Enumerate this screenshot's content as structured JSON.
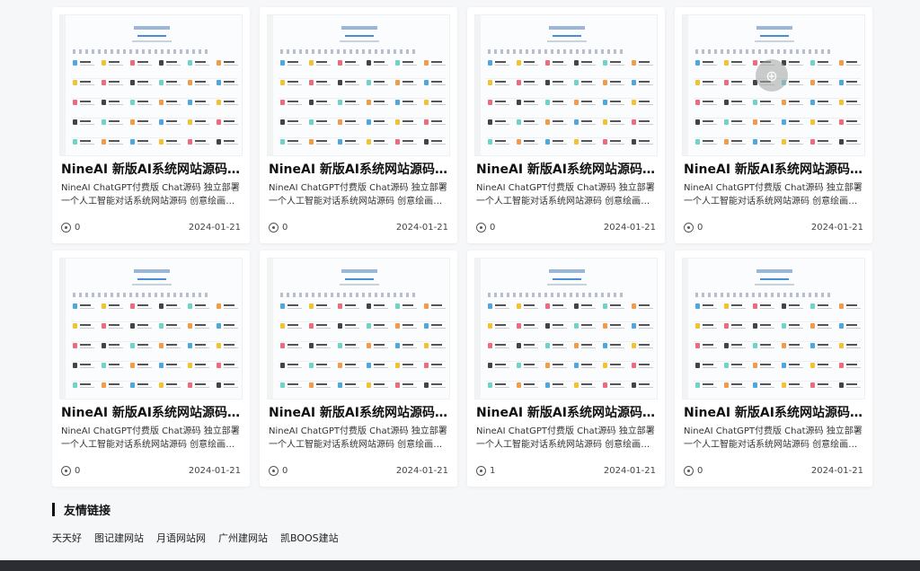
{
  "colors": {
    "page_bg": "#f6f7f9",
    "card_bg": "#ffffff",
    "footer_bg": "#2b2d33",
    "thumb_icon_colors": [
      "#4ea8de",
      "#f2c230",
      "#ee6a7c",
      "#444444",
      "#6fd3c9",
      "#f29c4a"
    ]
  },
  "cards": [
    {
      "title": "NineAI 新版AI系统网站源码 ...",
      "desc": "NineAI ChatGPT付费版 Chat源码 独立部署 一个人工智能对话系统网站源码 创意绘画工具 在线图片生成工具",
      "views": "0",
      "date": "2024-01-21"
    },
    {
      "title": "NineAI 新版AI系统网站源码 C...",
      "desc": "NineAI ChatGPT付费版 Chat源码 独立部署 一个人工智能对话系统网站源码 创意绘画工具 在线图片生成工具",
      "views": "0",
      "date": "2024-01-21"
    },
    {
      "title": "NineAI 新版AI系统网站源码 C...",
      "desc": "NineAI ChatGPT付费版 Chat源码 独立部署 一个人工智能对话系统网站源码 创意绘画工具 在线图片生成工具",
      "views": "0",
      "date": "2024-01-21"
    },
    {
      "title": "NineAI 新版AI系统网站源码 C...",
      "desc": "NineAI ChatGPT付费版 Chat源码 独立部署 一个人工智能对话系统网站源码 创意绘画工具 在线图片生成工具",
      "views": "0",
      "date": "2024-01-21"
    },
    {
      "title": "NineAI 新版AI系统网站源码 ...",
      "desc": "NineAI ChatGPT付费版 Chat源码 独立部署 一个人工智能对话系统网站源码 创意绘画工具 在线图片生成工具",
      "views": "0",
      "date": "2024-01-21"
    },
    {
      "title": "NineAI 新版AI系统网站源码 C...",
      "desc": "NineAI ChatGPT付费版 Chat源码 独立部署 一个人工智能对话系统网站源码 创意绘画工具 在线图片生成工具",
      "views": "0",
      "date": "2024-01-21"
    },
    {
      "title": "NineAI 新版AI系统网站源码 C...",
      "desc": "NineAI ChatGPT付费版 Chat源码 独立部署 一个人工智能对话系统网站源码 创意绘画工具 在线图片生成工具",
      "views": "1",
      "date": "2024-01-21"
    },
    {
      "title": "NineAI 新版AI系统网站源码 C...",
      "desc": "NineAI ChatGPT付费版 Chat源码 独立部署 一个人工智能对话系统网站源码 创意绘画工具 在线图片生成工具",
      "views": "0",
      "date": "2024-01-21"
    }
  ],
  "hover_card_index": 3,
  "hover_icon": "link-icon",
  "friend_links": {
    "title": "友情链接",
    "items": [
      "天天好",
      "图记建网站",
      "月语网站网",
      "广州建网站",
      "凯BOOS建站"
    ]
  }
}
